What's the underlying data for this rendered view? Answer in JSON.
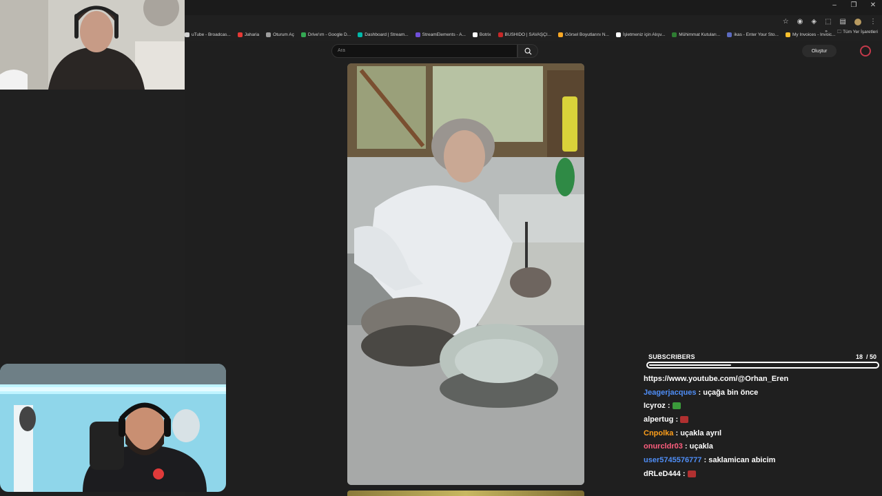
{
  "window_controls": {
    "minimize": "–",
    "restore": "❐",
    "close": "✕"
  },
  "bookmarks": [
    {
      "label": "uTube - Broadcas...",
      "color": "#d0d0d0"
    },
    {
      "label": "Jaharia",
      "color": "#e53935"
    },
    {
      "label": "Oturum Aç",
      "color": "#9e9e9e"
    },
    {
      "label": "Drive'ım - Google D...",
      "color": "#34a853"
    },
    {
      "label": "Dashboard | Stream...",
      "color": "#00b8a9"
    },
    {
      "label": "StreamElements - A...",
      "color": "#6f4fd8"
    },
    {
      "label": "Botrix",
      "color": "#ffffff"
    },
    {
      "label": "BUSHIDO | SAVAŞÇI...",
      "color": "#c62828"
    },
    {
      "label": "Görsel Boyutlarını N...",
      "color": "#f9a825"
    },
    {
      "label": "İşletmeniz için Alışv...",
      "color": "#ffffff"
    },
    {
      "label": "Mühimmat Kutuları...",
      "color": "#2e7d32"
    },
    {
      "label": "ikas - Enter Your Sto...",
      "color": "#5c6bc0"
    },
    {
      "label": "My Invoices - Invoic...",
      "color": "#fbc02d"
    }
  ],
  "bookmarks_more": "»",
  "bookmarks_all": "Tüm Yer İşaretleri",
  "search": {
    "placeholder": "Ara"
  },
  "header": {
    "create_label": "Oluştur"
  },
  "subscribers": {
    "label": "SUBSCRIBERS",
    "count": "18",
    "goal": "/ 50",
    "progress": 0.36
  },
  "chat": [
    {
      "user": "",
      "message": "https://www.youtube.com/@Orhan_Eren",
      "color": "#ffffff",
      "emote": null
    },
    {
      "user": "Jeagerjacques",
      "message": "uçağa bin önce",
      "color": "#4f8ef7",
      "emote": null
    },
    {
      "user": "Icyroz",
      "message": "",
      "color": "#ffffff",
      "emote": "#3a9a3a"
    },
    {
      "user": "alpertug",
      "message": "",
      "color": "#ffffff",
      "emote": "#b03030"
    },
    {
      "user": "Cnpolka",
      "message": "uçakla ayrıl",
      "color": "#ff9f1a",
      "emote": null
    },
    {
      "user": "onurcldr03",
      "message": "uçakla",
      "color": "#ff5e7e",
      "emote": null
    },
    {
      "user": "user5745576777",
      "message": "saklamican abicim",
      "color": "#4f8ef7",
      "emote": null
    },
    {
      "user": "dRLeD444",
      "message": "",
      "color": "#ffffff",
      "emote": "#b03030"
    }
  ]
}
